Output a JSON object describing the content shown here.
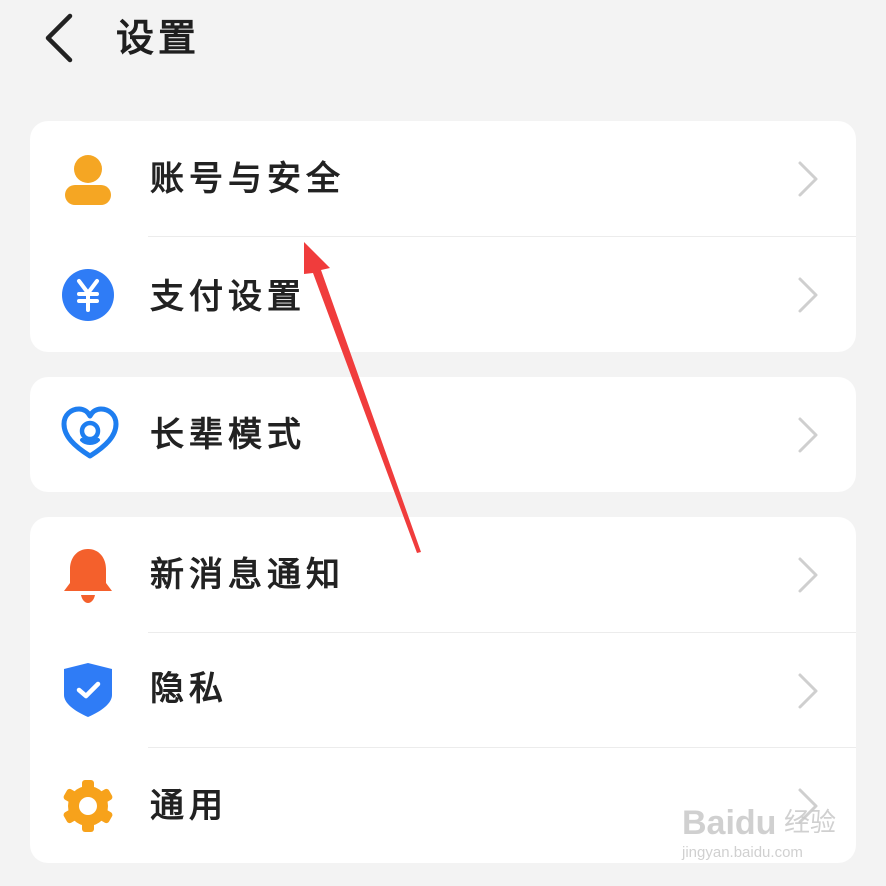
{
  "header": {
    "title": "设置",
    "back_icon": "chevron-left-icon"
  },
  "groups": [
    {
      "items": [
        {
          "label": "账号与安全",
          "icon": "person-icon",
          "icon_color": "#f5a623"
        },
        {
          "label": "支付设置",
          "icon": "yuan-icon",
          "icon_color": "#2f7cf6"
        }
      ]
    },
    {
      "items": [
        {
          "label": "长辈模式",
          "icon": "heart-icon",
          "icon_color": "#1e7ef0"
        }
      ]
    },
    {
      "items": [
        {
          "label": "新消息通知",
          "icon": "bell-icon",
          "icon_color": "#f4602c"
        },
        {
          "label": "隐私",
          "icon": "shield-check-icon",
          "icon_color": "#2f7cf6"
        },
        {
          "label": "通用",
          "icon": "gear-icon",
          "icon_color": "#f7a21b"
        }
      ]
    }
  ],
  "chevron_icon": "chevron-right-icon",
  "annotation": {
    "arrow_color": "#f03c3c"
  },
  "watermark": {
    "brand": "Baidu",
    "brand_cn": "经验",
    "url": "jingyan.baidu.com"
  }
}
